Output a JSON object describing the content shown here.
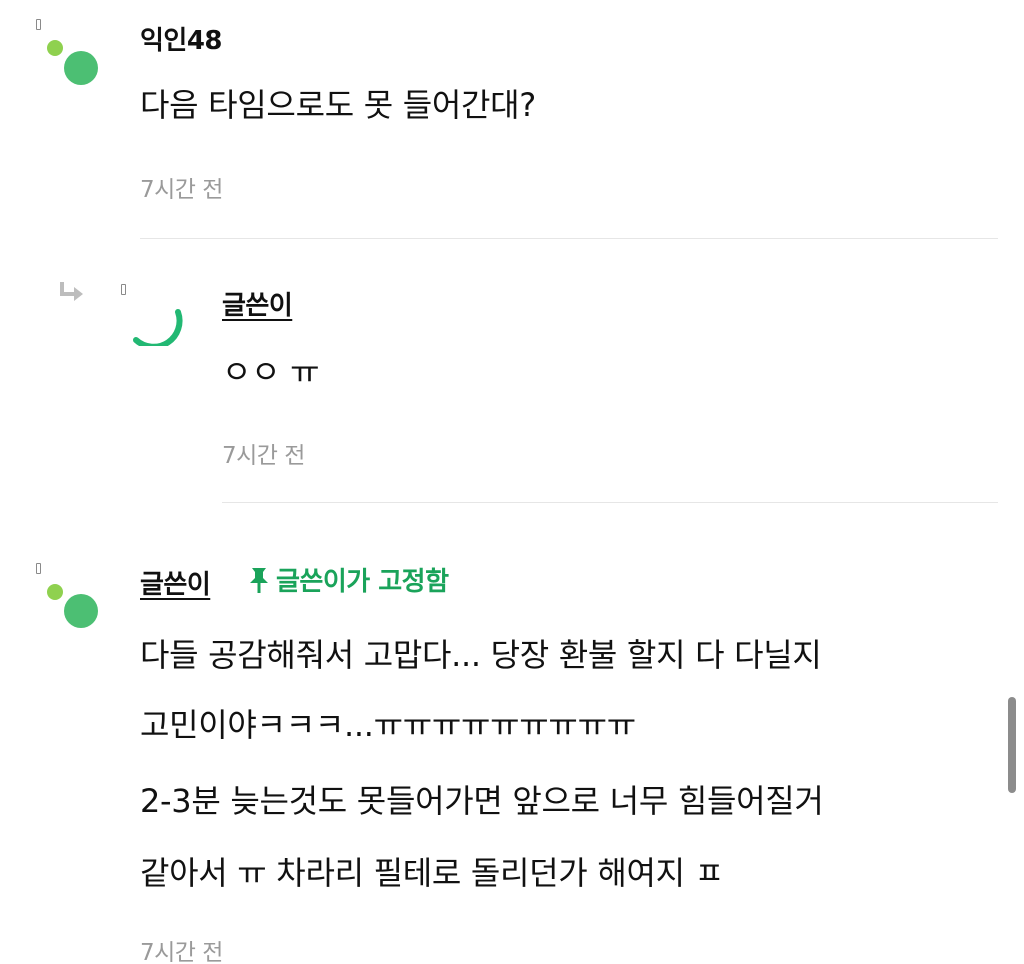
{
  "comments": [
    {
      "author": "익인48",
      "lines": [
        "다음 타임으로도 못 들어간대?"
      ],
      "time": "7시간 전"
    },
    {
      "author": "글쓴이",
      "lines": [
        "ㅇㅇ ㅠ"
      ],
      "time": "7시간 전"
    },
    {
      "author": "글쓴이",
      "pinned_label": "글쓴이가 고정함",
      "lines": [
        "다들 공감해줘서 고맙다... 당장 환불 할지 다 다닐지",
        "고민이야ㅋㅋㅋ...ㅠㅠㅠㅠㅠㅠㅠㅠㅠ",
        "2-3분 늦는것도 못들어가면 앞으로 너무 힘들어질거",
        "같아서 ㅠ 차라리 필테로 돌리던가 해여지 ㅍ"
      ],
      "time": "7시간 전"
    }
  ],
  "icons": {
    "reply": "reply-arrow-icon",
    "pin": "pin-icon",
    "avatar": "avatar-dots"
  },
  "colors": {
    "accent_green": "#1aa35a",
    "avatar_dot_light": "#8fd14f",
    "avatar_dot_dark": "#4cbf73",
    "timestamp": "#9a9a9a",
    "divider": "#e6e6e6"
  }
}
